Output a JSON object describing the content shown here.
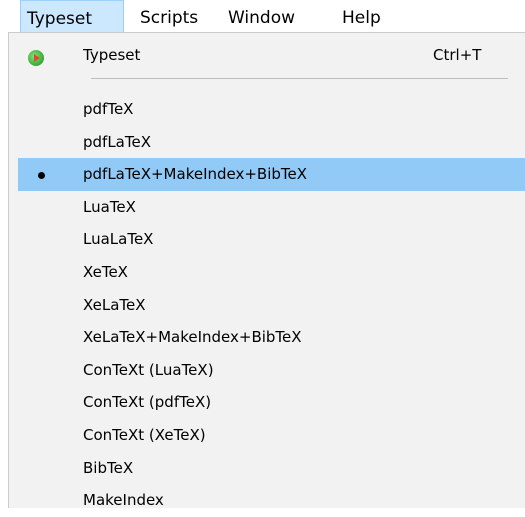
{
  "menubar": {
    "items": [
      {
        "label": "Typeset"
      },
      {
        "label": "Scripts"
      },
      {
        "label": "Window"
      },
      {
        "label": "Help"
      }
    ]
  },
  "menu": {
    "run": {
      "label": "Typeset",
      "shortcut": "Ctrl+T",
      "icon": "typeset-go-icon"
    },
    "engines": [
      {
        "label": "pdfTeX"
      },
      {
        "label": "pdfLaTeX"
      },
      {
        "label": "pdfLaTeX+MakeIndex+BibTeX",
        "selected": true
      },
      {
        "label": "LuaTeX"
      },
      {
        "label": "LuaLaTeX"
      },
      {
        "label": "XeTeX"
      },
      {
        "label": "XeLaTeX"
      },
      {
        "label": "XeLaTeX+MakeIndex+BibTeX"
      },
      {
        "label": "ConTeXt (LuaTeX)"
      },
      {
        "label": "ConTeXt (pdfTeX)"
      },
      {
        "label": "ConTeXt (XeTeX)"
      },
      {
        "label": "BibTeX"
      },
      {
        "label": "MakeIndex"
      }
    ]
  },
  "colors": {
    "active_menu_bg": "#cce8ff",
    "selected_item_bg": "#91c9f7",
    "menu_bg": "#f2f2f2"
  }
}
